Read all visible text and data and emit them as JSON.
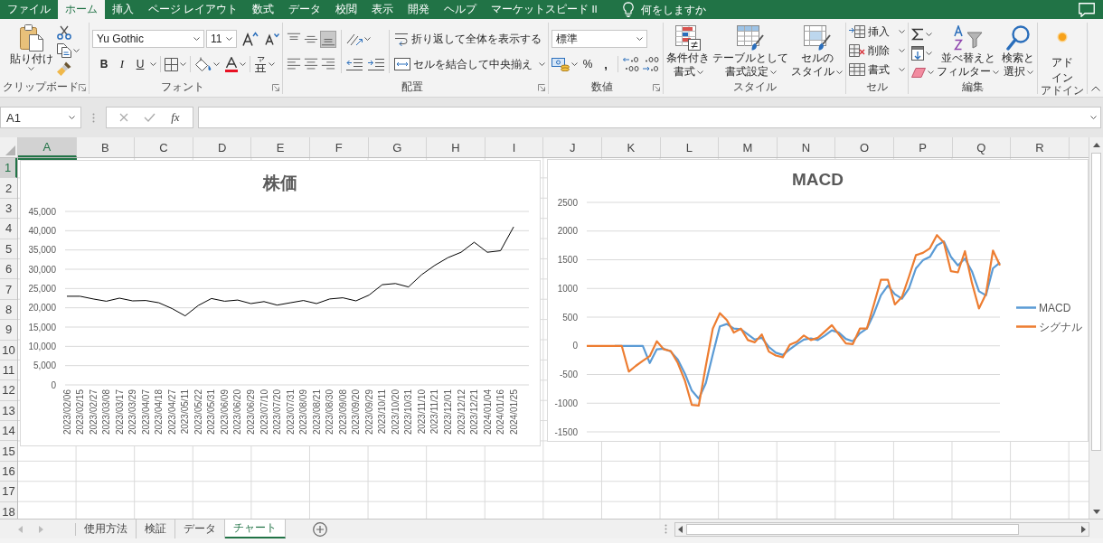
{
  "ribbon_tabs": [
    {
      "label": "ファイル",
      "selected": false
    },
    {
      "label": "ホーム",
      "selected": true
    },
    {
      "label": "挿入",
      "selected": false
    },
    {
      "label": "ページ レイアウト",
      "selected": false
    },
    {
      "label": "数式",
      "selected": false
    },
    {
      "label": "データ",
      "selected": false
    },
    {
      "label": "校閲",
      "selected": false
    },
    {
      "label": "表示",
      "selected": false
    },
    {
      "label": "開発",
      "selected": false
    },
    {
      "label": "ヘルプ",
      "selected": false
    },
    {
      "label": "マーケットスピード II",
      "selected": false
    }
  ],
  "tell_me": {
    "placeholder": "何をしますか"
  },
  "ribbon": {
    "clipboard": {
      "label": "クリップボード",
      "paste": "貼り付け"
    },
    "font": {
      "label": "フォント",
      "font_name": "Yu Gothic",
      "font_size": "11",
      "bold": "B",
      "italic": "I",
      "underline": "U"
    },
    "alignment": {
      "label": "配置",
      "vertical_align": [
        {
          "kind": "top",
          "selected": false
        },
        {
          "kind": "middle",
          "selected": false
        },
        {
          "kind": "bottom",
          "selected": true
        }
      ],
      "horizontal_align": [
        {
          "kind": "left",
          "selected": false
        },
        {
          "kind": "center",
          "selected": false
        },
        {
          "kind": "right",
          "selected": false
        }
      ],
      "wrap_text": "折り返して全体を表示する",
      "merge_center": "セルを結合して中央揃え"
    },
    "number": {
      "label": "数値",
      "format": "標準",
      "percent": "%",
      "comma": ","
    },
    "styles": {
      "label": "スタイル",
      "buttons": [
        {
          "kind": "conditional",
          "lines": [
            "条件付き",
            "書式"
          ]
        },
        {
          "kind": "table",
          "lines": [
            "テーブルとして",
            "書式設定"
          ]
        },
        {
          "kind": "cell_styles",
          "lines": [
            "セルの",
            "スタイル"
          ]
        }
      ]
    },
    "cells": {
      "label": "セル",
      "buttons": [
        {
          "kind": "insert",
          "label": "挿入"
        },
        {
          "kind": "delete",
          "label": "削除"
        },
        {
          "kind": "format",
          "label": "書式"
        }
      ]
    },
    "editing": {
      "label": "編集",
      "buttons": [
        {
          "kind": "sort_filter",
          "lines": [
            "並べ替えと",
            "フィルター"
          ]
        },
        {
          "kind": "find",
          "lines": [
            "検索と",
            "選択"
          ]
        }
      ]
    },
    "addin": {
      "label": "アドイン",
      "button_lines": [
        "アド",
        "イン"
      ]
    }
  },
  "formula_bar": {
    "name_box": {
      "value": "A1"
    },
    "fx": "fx"
  },
  "sheet": {
    "columns": [
      {
        "label": "A",
        "selected": true
      },
      {
        "label": "B",
        "selected": false
      },
      {
        "label": "C",
        "selected": false
      },
      {
        "label": "D",
        "selected": false
      },
      {
        "label": "E",
        "selected": false
      },
      {
        "label": "F",
        "selected": false
      },
      {
        "label": "G",
        "selected": false
      },
      {
        "label": "H",
        "selected": false
      },
      {
        "label": "I",
        "selected": false
      },
      {
        "label": "J",
        "selected": false
      },
      {
        "label": "K",
        "selected": false
      },
      {
        "label": "L",
        "selected": false
      },
      {
        "label": "M",
        "selected": false
      },
      {
        "label": "N",
        "selected": false
      },
      {
        "label": "O",
        "selected": false
      },
      {
        "label": "P",
        "selected": false
      },
      {
        "label": "Q",
        "selected": false
      },
      {
        "label": "R",
        "selected": false
      }
    ],
    "rows": [
      {
        "label": "1",
        "selected": true
      },
      {
        "label": "2",
        "selected": false
      },
      {
        "label": "3",
        "selected": false
      },
      {
        "label": "4",
        "selected": false
      },
      {
        "label": "5",
        "selected": false
      },
      {
        "label": "6",
        "selected": false
      },
      {
        "label": "7",
        "selected": false
      },
      {
        "label": "8",
        "selected": false
      },
      {
        "label": "9",
        "selected": false
      },
      {
        "label": "10",
        "selected": false
      },
      {
        "label": "11",
        "selected": false
      },
      {
        "label": "12",
        "selected": false
      },
      {
        "label": "13",
        "selected": false
      },
      {
        "label": "14",
        "selected": false
      },
      {
        "label": "15",
        "selected": false
      },
      {
        "label": "16",
        "selected": false
      },
      {
        "label": "17",
        "selected": false
      },
      {
        "label": "18",
        "selected": false
      }
    ],
    "active_cell": {
      "selected": true
    },
    "charts": [
      {
        "chart_data": {
          "type": "line",
          "title": "株価",
          "grid": true,
          "categories": [
            "2023/02/06",
            "2023/02/15",
            "2023/02/27",
            "2023/03/08",
            "2023/03/17",
            "2023/03/29",
            "2023/04/07",
            "2023/04/18",
            "2023/04/27",
            "2023/05/11",
            "2023/05/22",
            "2023/05/31",
            "2023/06/09",
            "2023/06/20",
            "2023/06/29",
            "2023/07/10",
            "2023/07/20",
            "2023/07/31",
            "2023/08/09",
            "2023/08/21",
            "2023/08/30",
            "2023/09/08",
            "2023/09/20",
            "2023/09/29",
            "2023/10/11",
            "2023/10/20",
            "2023/10/31",
            "2023/11/10",
            "2023/11/21",
            "2023/12/01",
            "2023/12/12",
            "2023/12/21",
            "2024/01/04",
            "2024/01/16",
            "2024/01/25"
          ],
          "values": [
            23000,
            23000,
            22300,
            21700,
            22500,
            21800,
            21900,
            21300,
            19800,
            17900,
            20600,
            22400,
            21700,
            22000,
            21100,
            21600,
            20700,
            21300,
            21900,
            21100,
            22300,
            22600,
            21800,
            23300,
            26000,
            26300,
            25400,
            28600,
            31000,
            33000,
            34400,
            37000,
            34400,
            34800,
            41000
          ],
          "ylim": [
            0,
            45000
          ],
          "yticks": [
            0,
            {
              "value": 5000,
              "label": "5,000"
            },
            {
              "value": 10000,
              "label": "10,000"
            },
            {
              "value": 15000,
              "label": "15,000"
            },
            {
              "value": 20000,
              "label": "20,000"
            },
            {
              "value": 25000,
              "label": "25,000"
            },
            {
              "value": 30000,
              "label": "30,000"
            },
            {
              "value": 35000,
              "label": "35,000"
            },
            {
              "value": 40000,
              "label": "40,000"
            },
            {
              "value": 45000,
              "label": "45,000"
            }
          ]
        }
      },
      {
        "chart_data": {
          "type": "line",
          "title": "MACD",
          "grid": true,
          "legend": "right",
          "series": [
            {
              "name": "MACD",
              "color": "#5b9bd5",
              "values": [
                null,
                null,
                null,
                null,
                0,
                0,
                0,
                0,
                0,
                -300,
                -60,
                -50,
                -100,
                -240,
                -480,
                -780,
                -920,
                -650,
                -150,
                340,
                380,
                300,
                290,
                200,
                110,
                140,
                -20,
                -120,
                -160,
                -60,
                30,
                110,
                130,
                100,
                180,
                270,
                230,
                120,
                80,
                220,
                300,
                560,
                880,
                1050,
                900,
                820,
                1000,
                1350,
                1490,
                1550,
                1750,
                1820,
                1550,
                1400,
                1520,
                1300,
                950,
                880,
                1350,
                1450
              ]
            },
            {
              "name": "シグナル",
              "color": "#ed7d31",
              "values": [
                0,
                0,
                0,
                0,
                0,
                0,
                -450,
                -350,
                -260,
                -180,
                80,
                -60,
                -90,
                -300,
                -600,
                -1030,
                -1040,
                -350,
                300,
                570,
                450,
                230,
                300,
                100,
                60,
                200,
                -100,
                -170,
                -200,
                20,
                70,
                180,
                100,
                140,
                250,
                360,
                200,
                40,
                30,
                300,
                300,
                720,
                1150,
                1150,
                720,
                850,
                1200,
                1580,
                1620,
                1700,
                1930,
                1800,
                1300,
                1280,
                1650,
                1100,
                650,
                900,
                1660,
                1400
              ]
            }
          ],
          "ylim": [
            -1500,
            2500
          ],
          "yticks": [
            -1500,
            -1000,
            -500,
            0,
            500,
            1000,
            1500,
            2000,
            2500
          ]
        }
      }
    ]
  },
  "sheet_tabs": [
    {
      "label": "使用方法",
      "selected": false
    },
    {
      "label": "検証",
      "selected": false
    },
    {
      "label": "データ",
      "selected": false
    },
    {
      "label": "チャート",
      "selected": true
    }
  ]
}
